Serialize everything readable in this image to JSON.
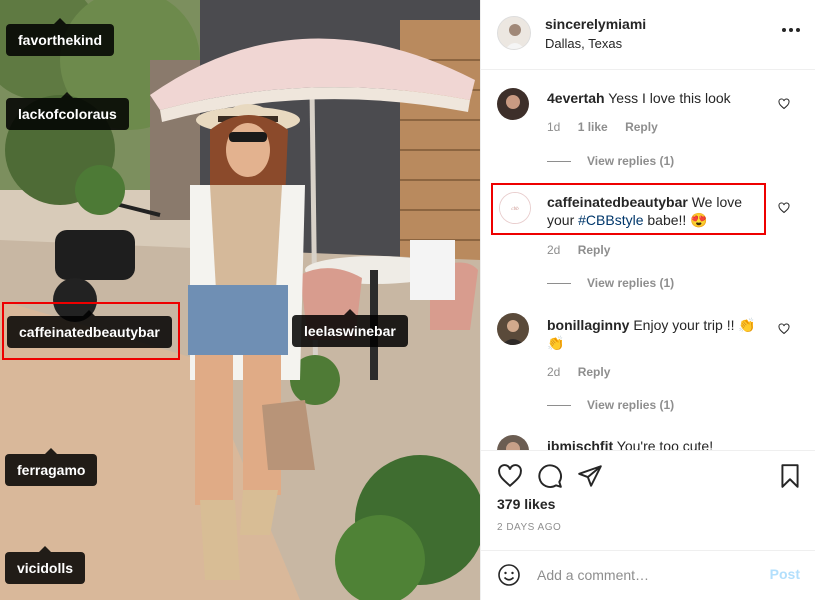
{
  "photo": {
    "tags": [
      "favorthekind",
      "lackofcoloraus",
      "caffeinatedbeautybar",
      "leelaswinebar",
      "ferragamo",
      "vicidolls"
    ]
  },
  "header": {
    "username": "sincerelymiami",
    "location": "Dallas, Texas"
  },
  "comments": [
    {
      "user": "4evertah",
      "text": "Yess I love this look",
      "age": "1d",
      "likes": "1 like",
      "reply": "Reply",
      "view_replies": "View replies (1)"
    },
    {
      "user": "caffeinatedbeautybar",
      "text_before": "We love your ",
      "hashtag": "#CBBstyle",
      "text_after": " babe!! 😍",
      "age": "2d",
      "reply": "Reply",
      "view_replies": "View replies (1)"
    },
    {
      "user": "bonillaginny",
      "text": "Enjoy your trip !! 👏👏",
      "age": "2d",
      "reply": "Reply",
      "view_replies": "View replies (1)"
    },
    {
      "user": "jbmischfit",
      "text": "You're too cute!"
    }
  ],
  "actions": {
    "likes": "379 likes",
    "posted": "2 DAYS AGO"
  },
  "add_comment": {
    "placeholder": "Add a comment…",
    "post_label": "Post"
  },
  "colors": {
    "highlight": "#e00000",
    "hashtag": "#00376b",
    "post_disabled": "#b2dffc"
  }
}
